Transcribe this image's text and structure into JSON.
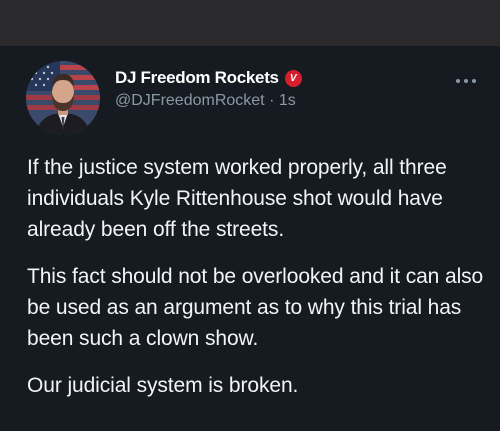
{
  "author": {
    "display_name": "DJ Freedom Rockets",
    "handle": "@DJFreedomRocket",
    "separator": "·",
    "time": "1s",
    "badge_letter": "V",
    "badge_color": "#d61f2c"
  },
  "icons": {
    "more": "more-horizontal-icon",
    "verified": "verified-badge-icon"
  },
  "tweet": {
    "paragraphs": [
      "If the justice system worked properly, all three individuals Kyle Rittenhouse shot would have already been off the streets.",
      "This fact should not be overlooked and it can also be used as an argument as to why this trial has been such a clown show.",
      "Our judicial system is broken."
    ]
  },
  "colors": {
    "background": "#161b22",
    "topbar": "#2a2a2c",
    "text": "#f2f4f5",
    "muted": "#8b98a5"
  }
}
